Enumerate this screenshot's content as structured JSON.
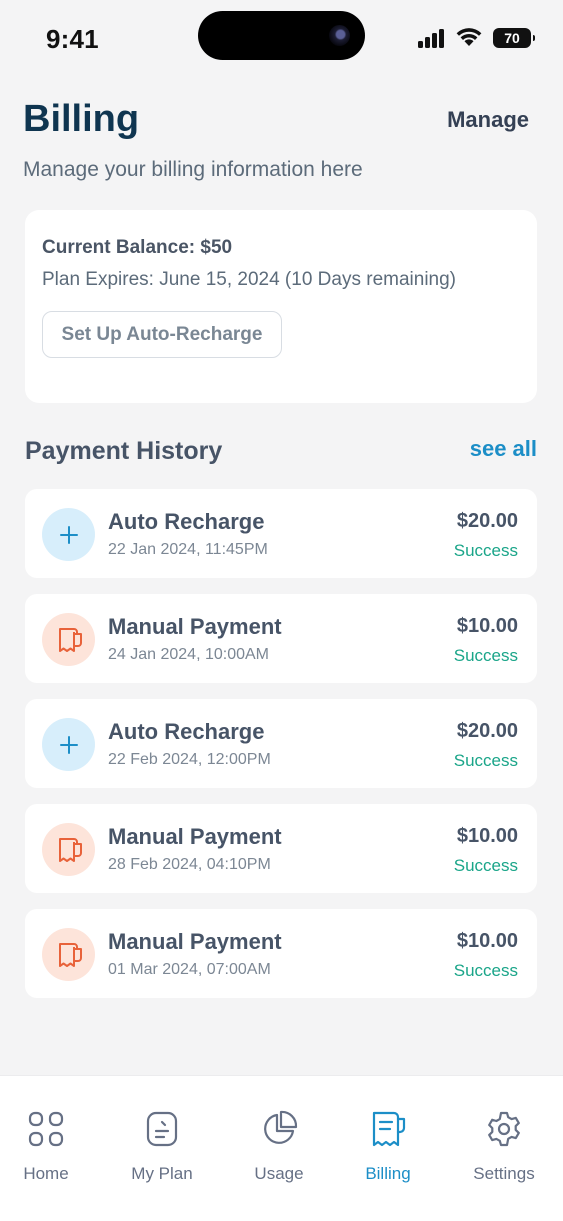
{
  "status": {
    "time": "9:41",
    "battery": "70"
  },
  "header": {
    "title": "Billing",
    "manage_label": "Manage",
    "subtitle": "Manage your billing information here"
  },
  "balance": {
    "current": "Current Balance: $50",
    "expiry": "Plan Expires: June 15, 2024 (10 Days remaining)",
    "auto_recharge_label": "Set Up Auto-Recharge"
  },
  "history": {
    "title": "Payment History",
    "see_all": "see all",
    "items": [
      {
        "type": "auto",
        "title": "Auto Recharge",
        "date": "22 Jan 2024, 11:45PM",
        "amount": "$20.00",
        "status": "Success"
      },
      {
        "type": "manual",
        "title": "Manual Payment",
        "date": "24 Jan 2024, 10:00AM",
        "amount": "$10.00",
        "status": "Success"
      },
      {
        "type": "auto",
        "title": "Auto Recharge",
        "date": "22 Feb 2024, 12:00PM",
        "amount": "$20.00",
        "status": "Success"
      },
      {
        "type": "manual",
        "title": "Manual Payment",
        "date": "28 Feb 2024, 04:10PM",
        "amount": "$10.00",
        "status": "Success"
      },
      {
        "type": "manual",
        "title": "Manual Payment",
        "date": "01 Mar 2024, 07:00AM",
        "amount": "$10.00",
        "status": "Success"
      }
    ]
  },
  "nav": {
    "items": [
      {
        "label": "Home",
        "icon": "grid-icon"
      },
      {
        "label": "My Plan",
        "icon": "document-icon"
      },
      {
        "label": "Usage",
        "icon": "pie-chart-icon"
      },
      {
        "label": "Billing",
        "icon": "receipt-icon",
        "active": true
      },
      {
        "label": "Settings",
        "icon": "gear-icon"
      }
    ]
  },
  "colors": {
    "accent": "#1c8ec7",
    "title": "#0f3550",
    "success": "#1aa589",
    "auto_icon_bg": "#d7eefb",
    "manual_icon_bg": "#fde4da",
    "manual_icon": "#e8623a"
  }
}
